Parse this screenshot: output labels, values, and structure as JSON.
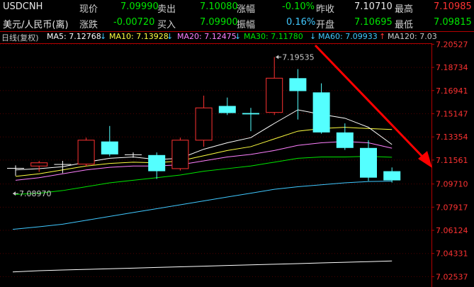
{
  "quote": {
    "symbol": "USDCNH",
    "name": "美元/人民币(离)",
    "fields": {
      "last_label": "现价",
      "last_value": "7.09990",
      "ask_label": "卖出",
      "ask_value": "7.10080",
      "chgpct_label": "涨幅",
      "chgpct_value": "-0.10%",
      "prevclose_label": "昨收",
      "prevclose_value": "7.10710",
      "high_label": "最高",
      "high_value": "7.10985",
      "chg_label": "涨跌",
      "chg_value": "-0.00720",
      "bid_label": "买入",
      "bid_value": "7.09900",
      "amp_label": "振幅",
      "amp_value": "0.16%",
      "open_label": "开盘",
      "open_value": "7.10695",
      "low_label": "最低",
      "low_value": "7.09815"
    }
  },
  "ma_bar": {
    "period": "日线(复权)",
    "ma5": "MA5: 7.12768",
    "ma10": "MA10: 7.13928",
    "ma20": "MA20: 7.12475",
    "ma30": "MA30: 7.11780",
    "ma60": "MA60: 7.09933",
    "ma120": "MA120: 7.03",
    "arrow_down": "↓",
    "arrow_up": "↑"
  },
  "colors": {
    "up": "#ff3232",
    "down": "#54ffff",
    "axis": "#b40000",
    "ma5": "#ffffff",
    "ma10": "#ffff40",
    "ma20": "#ff80ff",
    "ma30": "#00e600",
    "ma60": "#40c8ff",
    "ma120": "#ffffff",
    "trend_arrow": "#ff0000"
  },
  "chart_data": {
    "type": "candlestick",
    "ylim": [
      7.0245,
      7.2055
    ],
    "y_ticks": [
      "7.20527",
      "7.18734",
      "7.16941",
      "7.15147",
      "7.13354",
      "7.11561",
      "7.09710",
      "7.07917",
      "7.06124",
      "7.04331",
      "7.02537"
    ],
    "candles": [
      {
        "o": 7.1095,
        "c": 7.1095,
        "h": 7.1115,
        "l": 7.1035
      },
      {
        "o": 7.111,
        "c": 7.1135,
        "h": 7.115,
        "l": 7.1065
      },
      {
        "o": 7.1125,
        "c": 7.1125,
        "h": 7.115,
        "l": 7.1055
      },
      {
        "o": 7.1125,
        "c": 7.131,
        "h": 7.133,
        "l": 7.1105
      },
      {
        "o": 7.13,
        "c": 7.12,
        "h": 7.142,
        "l": 7.1185
      },
      {
        "o": 7.12,
        "c": 7.12,
        "h": 7.1215,
        "l": 7.1175
      },
      {
        "o": 7.1195,
        "c": 7.107,
        "h": 7.1215,
        "l": 7.101
      },
      {
        "o": 7.109,
        "c": 7.131,
        "h": 7.133,
        "l": 7.1075
      },
      {
        "o": 7.131,
        "c": 7.156,
        "h": 7.1655,
        "l": 7.126
      },
      {
        "o": 7.1575,
        "c": 7.152,
        "h": 7.164,
        "l": 7.1505
      },
      {
        "o": 7.152,
        "c": 7.151,
        "h": 7.156,
        "l": 7.138
      },
      {
        "o": 7.1525,
        "c": 7.179,
        "h": 7.1954,
        "l": 7.1505
      },
      {
        "o": 7.179,
        "c": 7.169,
        "h": 7.186,
        "l": 7.147
      },
      {
        "o": 7.168,
        "c": 7.137,
        "h": 7.175,
        "l": 7.136
      },
      {
        "o": 7.137,
        "c": 7.125,
        "h": 7.144,
        "l": 7.1235
      },
      {
        "o": 7.125,
        "c": 7.102,
        "h": 7.131,
        "l": 7.0995
      },
      {
        "o": 7.107,
        "c": 7.0999,
        "h": 7.1099,
        "l": 7.0982
      }
    ],
    "ma_lines": {
      "ma5": [
        7.108,
        7.109,
        7.1105,
        7.114,
        7.117,
        7.118,
        7.116,
        7.117,
        7.124,
        7.129,
        7.133,
        7.144,
        7.1545,
        7.151,
        7.148,
        7.141,
        7.1277
      ],
      "ma10": [
        7.103,
        7.105,
        7.108,
        7.111,
        7.113,
        7.114,
        7.1135,
        7.115,
        7.119,
        7.123,
        7.126,
        7.132,
        7.138,
        7.14,
        7.141,
        7.14,
        7.1393
      ],
      "ma20": [
        7.1,
        7.102,
        7.105,
        7.108,
        7.11,
        7.111,
        7.111,
        7.112,
        7.115,
        7.118,
        7.12,
        7.123,
        7.127,
        7.129,
        7.13,
        7.129,
        7.1248
      ],
      "ma30": [
        7.089,
        7.09,
        7.092,
        7.095,
        7.098,
        7.1,
        7.102,
        7.104,
        7.107,
        7.109,
        7.111,
        7.114,
        7.117,
        7.118,
        7.118,
        7.1185,
        7.1178
      ],
      "ma60": [
        7.062,
        7.064,
        7.066,
        7.069,
        7.072,
        7.075,
        7.078,
        7.081,
        7.084,
        7.087,
        7.09,
        7.093,
        7.095,
        7.0965,
        7.098,
        7.099,
        7.0993
      ],
      "ma120": [
        7.029,
        7.03,
        7.0305,
        7.031,
        7.0315,
        7.032,
        7.0325,
        7.033,
        7.0335,
        7.034,
        7.0345,
        7.035,
        7.0355,
        7.036,
        7.0365,
        7.037,
        7.0375
      ]
    },
    "annotations": [
      {
        "text": "7.19535",
        "candle": 11,
        "value": 7.19535
      },
      {
        "text": "7.08970",
        "candle": 0,
        "value": 7.0897
      }
    ]
  }
}
